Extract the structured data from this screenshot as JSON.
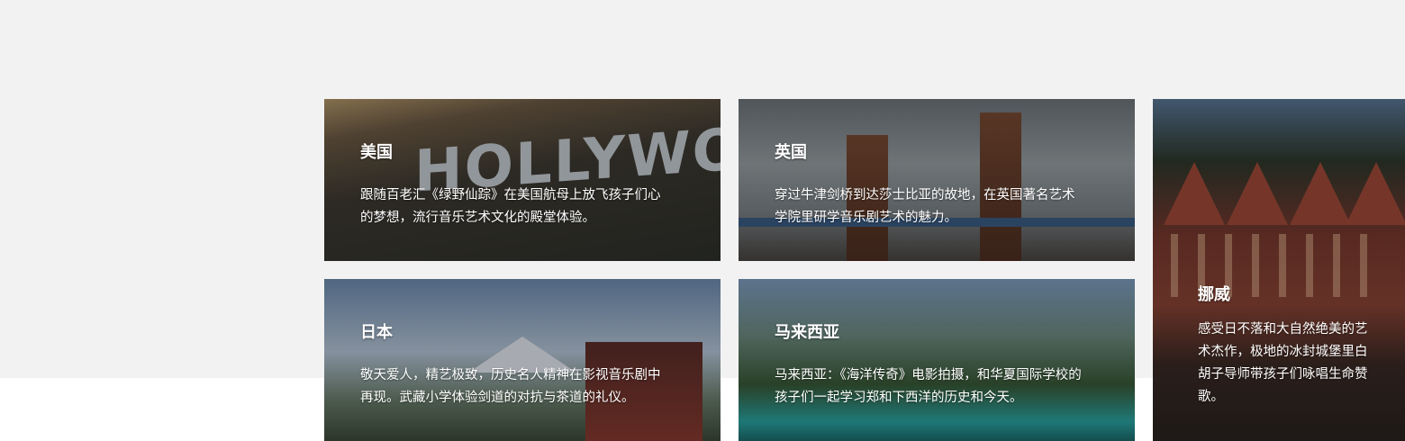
{
  "cards": [
    {
      "title": "美国",
      "desc": "跟随百老汇《绿野仙踪》在美国航母上放飞孩子们心的梦想，流行音乐艺术文化的殿堂体验。",
      "scene_text": "HOLLYWOOD"
    },
    {
      "title": "英国",
      "desc": "穿过牛津剑桥到达莎士比亚的故地，在英国著名艺术学院里研学音乐剧艺术的魅力。"
    },
    {
      "title": "挪威",
      "desc": "感受日不落和大自然绝美的艺术杰作，极地的冰封城堡里白胡子导师带孩子们咏唱生命赞歌。"
    },
    {
      "title": "日本",
      "desc": "敬天爱人，精艺极致，历史名人精神在影视音乐剧中再现。武藏小学体验剑道的对抗与茶道的礼仪。"
    },
    {
      "title": "马来西亚",
      "desc": "马来西亚：《海洋传奇》电影拍摄，和华夏国际学校的孩子们一起学习郑和下西洋的历史和今天。"
    }
  ]
}
